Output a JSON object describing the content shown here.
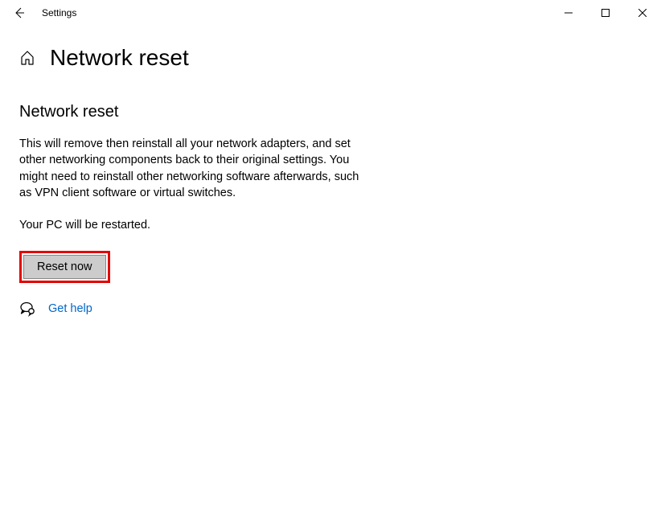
{
  "titlebar": {
    "app_title": "Settings"
  },
  "header": {
    "page_title": "Network reset"
  },
  "content": {
    "section_heading": "Network reset",
    "description": "This will remove then reinstall all your network adapters, and set other networking components back to their original settings. You might need to reinstall other networking software afterwards, such as VPN client software or virtual switches.",
    "restart_note": "Your PC will be restarted.",
    "reset_button_label": "Reset now",
    "help_link_label": "Get help"
  },
  "colors": {
    "link": "#0066cc",
    "highlight_border": "#e30000",
    "button_bg": "#cccccc"
  }
}
